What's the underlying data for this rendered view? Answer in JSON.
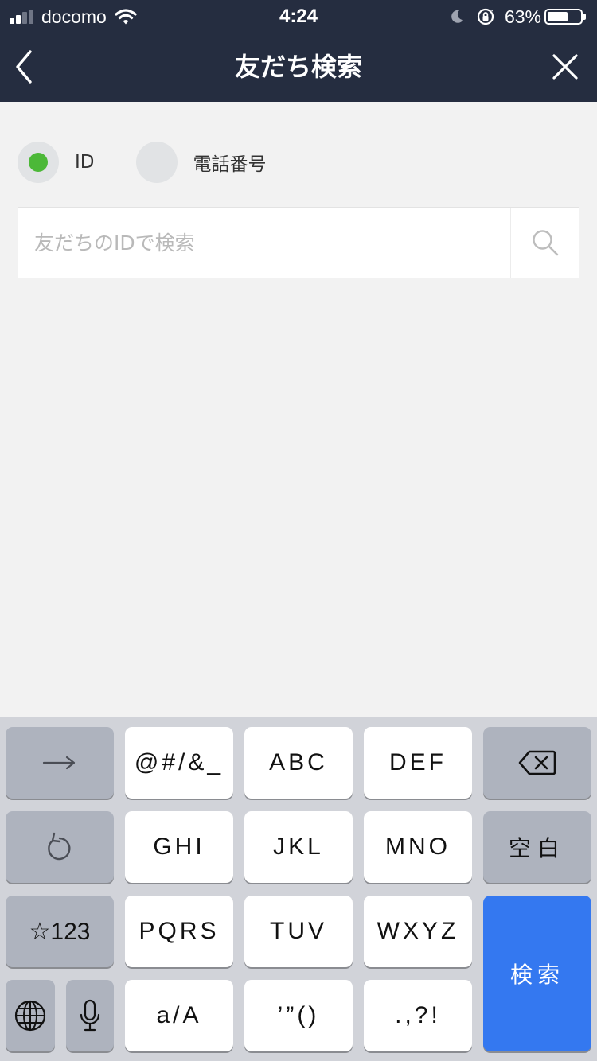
{
  "status_bar": {
    "carrier": "docomo",
    "time": "4:24",
    "battery_percent_text": "63%",
    "battery_level": 0.63,
    "signal_bars_filled": 2,
    "signal_bars_total": 4
  },
  "nav": {
    "title": "友だち検索",
    "back_icon": "chevron-left-icon",
    "close_icon": "close-icon"
  },
  "search_type": {
    "selected": "ID",
    "options": [
      {
        "label": "ID",
        "selected": true
      },
      {
        "label": "電話番号",
        "selected": false
      }
    ]
  },
  "search": {
    "value": "",
    "placeholder": "友だちのIDで検索",
    "icon": "search-icon"
  },
  "keyboard": {
    "keys": {
      "next": "→",
      "symbols": "@#/&_",
      "abc": "ABC",
      "def": "DEF",
      "ghi": "GHI",
      "jkl": "JKL",
      "mno": "MNO",
      "space": "空白",
      "num": "☆123",
      "pqrs": "PQRS",
      "tuv": "TUV",
      "wxyz": "WXYZ",
      "search": "検索",
      "case": "a/A",
      "quotes": "’”()",
      "punct": ".,?!"
    },
    "icons": {
      "delete": "delete-icon",
      "undo": "undo-icon",
      "globe": "globe-icon",
      "mic": "microphone-icon"
    }
  },
  "colors": {
    "header_bg": "#252d40",
    "content_bg": "#f2f2f2",
    "radio_selected": "#4cb838",
    "radio_unselected": "#e1e3e5",
    "keyboard_bg": "#d1d3d9",
    "search_key": "#3478f0"
  }
}
